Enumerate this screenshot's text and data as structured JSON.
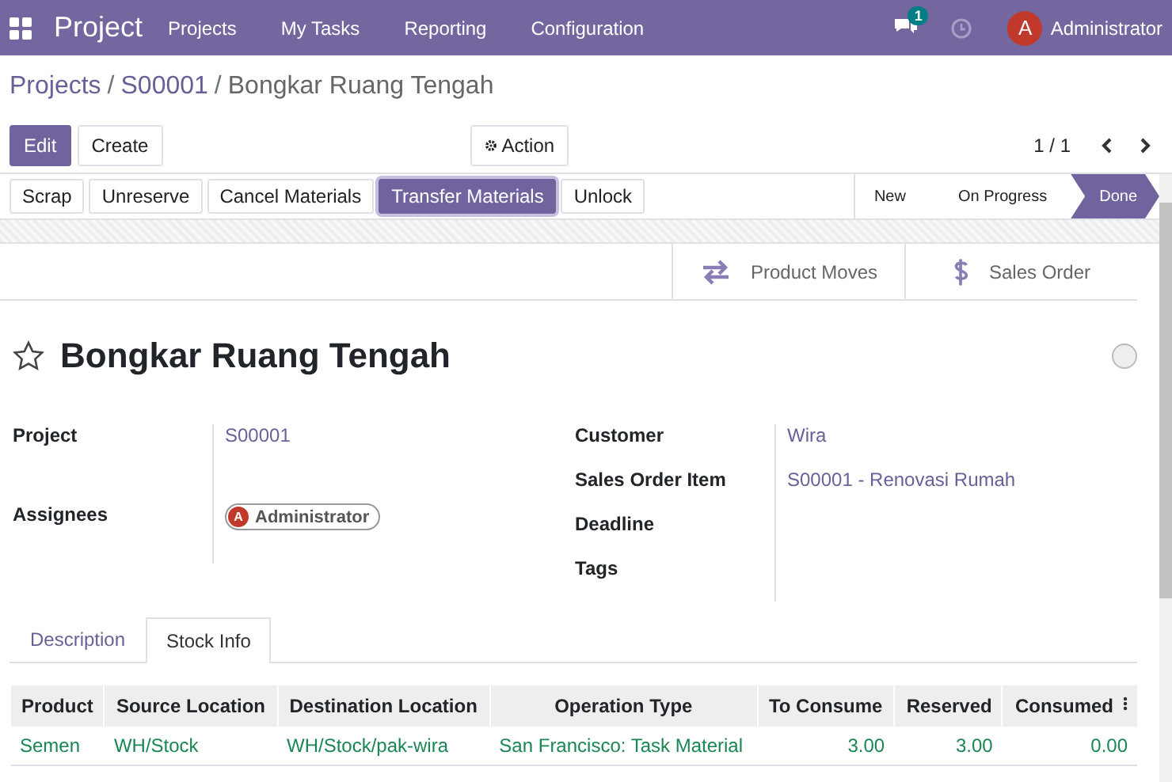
{
  "navbar": {
    "app": "Project",
    "menu": [
      "Projects",
      "My Tasks",
      "Reporting",
      "Configuration"
    ],
    "messages_badge": "1",
    "user_initial": "A",
    "user": "Administrator"
  },
  "breadcrumb": {
    "links": [
      "Projects",
      "S00001"
    ],
    "current": "Bongkar Ruang Tengah",
    "separator": "/"
  },
  "control_buttons": {
    "edit": "Edit",
    "create": "Create",
    "action": "Action",
    "pager": "1 / 1"
  },
  "header_buttons": [
    {
      "label": "Scrap",
      "primary": false
    },
    {
      "label": "Unreserve",
      "primary": false
    },
    {
      "label": "Cancel Materials",
      "primary": false
    },
    {
      "label": "Transfer Materials",
      "primary": true
    },
    {
      "label": "Unlock",
      "primary": false
    }
  ],
  "stages": [
    {
      "label": "New",
      "selected": false
    },
    {
      "label": "On Progress",
      "selected": false
    },
    {
      "label": "Done",
      "selected": true
    }
  ],
  "smart_buttons": [
    {
      "kind": "moves",
      "label": "Product Moves"
    },
    {
      "kind": "sales",
      "label": "Sales Order"
    }
  ],
  "title": "Bongkar Ruang Tengah",
  "starred": false,
  "left_fields": [
    {
      "label": "Project",
      "value": "S00001",
      "kind": "link"
    },
    {
      "label": "Assignees",
      "value": "Administrator",
      "initial": "A",
      "kind": "user"
    }
  ],
  "right_fields": [
    {
      "label": "Customer",
      "value": "Wira"
    },
    {
      "label": "Sales Order Item",
      "value": "S00001 - Renovasi Rumah"
    },
    {
      "label": "Deadline"
    },
    {
      "label": "Tags"
    }
  ],
  "notebook_tabs": [
    {
      "label": "Description",
      "selected": false
    },
    {
      "label": "Stock Info",
      "selected": true
    }
  ],
  "table": {
    "columns": [
      "Product",
      "Source Location",
      "Destination Location",
      "Operation Type",
      "To Consume",
      "Reserved",
      "Consumed"
    ],
    "rows": [
      [
        "Semen",
        "WH/Stock",
        "WH/Stock/pak-wira",
        "San Francisco: Task Material",
        "3.00",
        "3.00",
        "0.00"
      ]
    ]
  }
}
